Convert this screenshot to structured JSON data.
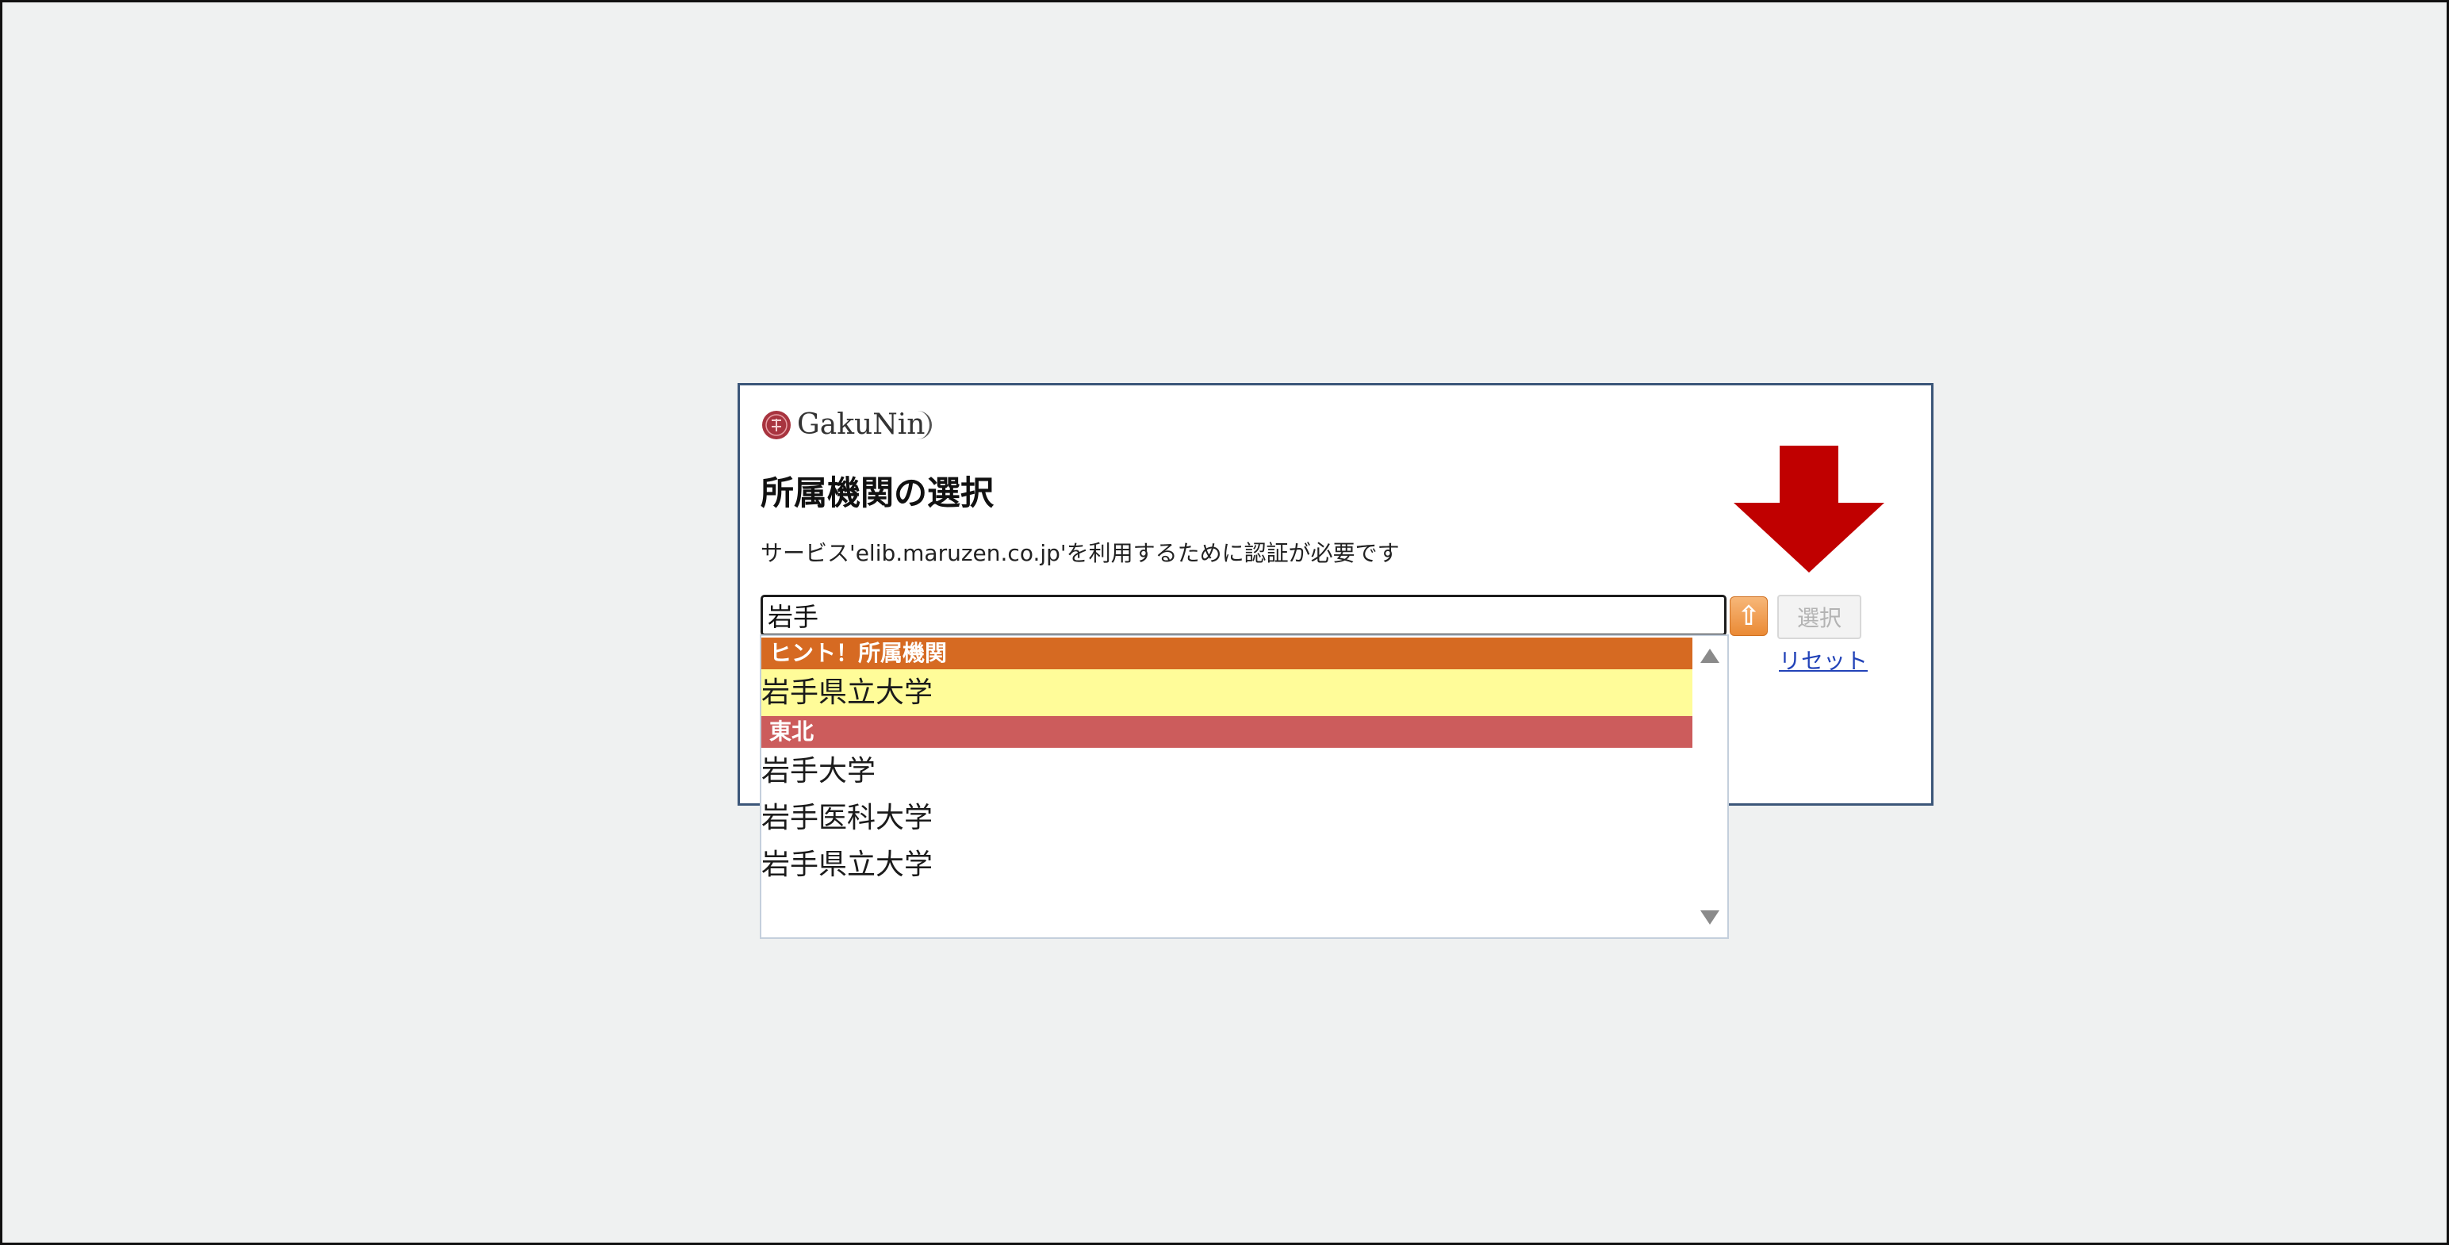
{
  "logo": {
    "text": "GakuNin"
  },
  "title": "所属機関の選択",
  "subtitle": "サービス'elib.maruzen.co.jp'を利用するために認証が必要です",
  "search": {
    "value": "岩手",
    "placeholder": ""
  },
  "buttons": {
    "toggle_icon": "⇧",
    "select_label": "選択",
    "reset_label": "リセット"
  },
  "dropdown": {
    "hint_header": "ヒント！所属機関",
    "hint_items": [
      "岩手県立大学"
    ],
    "region_header": "東北",
    "region_items": [
      "岩手大学",
      "岩手医科大学",
      "岩手県立大学"
    ]
  },
  "colors": {
    "hint_header_bg": "#d66a22",
    "region_header_bg": "#cc5c5c",
    "highlight_bg": "#fffc99",
    "arrow": "#c00000",
    "link": "#2243b8"
  },
  "icons": {
    "logo_seal": "gakunin-seal-icon",
    "toggle": "orange-up-arrow-icon",
    "annotation": "red-down-arrow-icon",
    "scroll_up": "scroll-up-icon",
    "scroll_down": "scroll-down-icon"
  }
}
